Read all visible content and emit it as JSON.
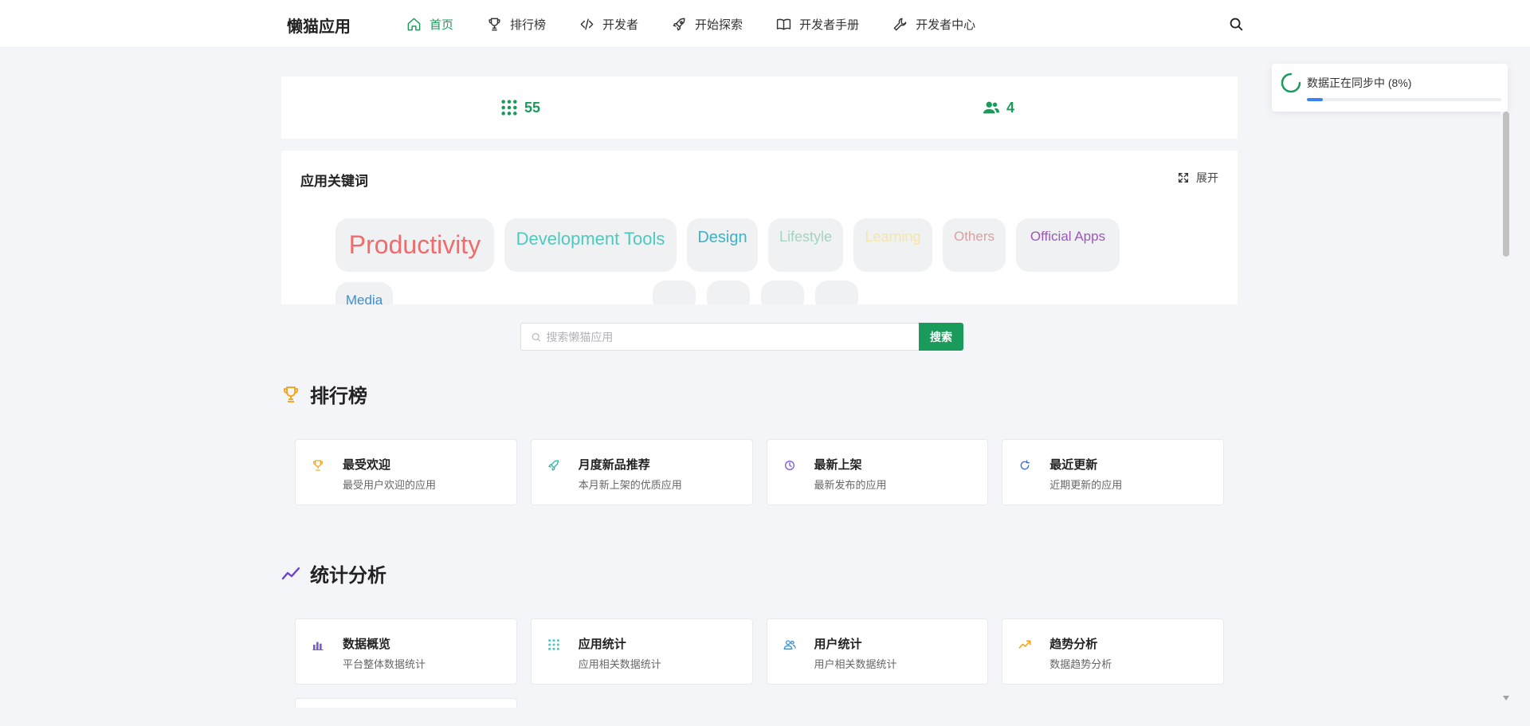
{
  "header": {
    "logo": "懒猫应用",
    "nav": [
      {
        "label": "首页",
        "icon": "home-icon",
        "active": true
      },
      {
        "label": "排行榜",
        "icon": "trophy-icon"
      },
      {
        "label": "开发者",
        "icon": "code-icon"
      },
      {
        "label": "开始探索",
        "icon": "rocket-icon"
      },
      {
        "label": "开发者手册",
        "icon": "book-icon"
      },
      {
        "label": "开发者中心",
        "icon": "wrench-icon"
      }
    ],
    "search_icon": "search-icon"
  },
  "stats": {
    "apps_count": "55",
    "apps_icon": "grid-dots-icon",
    "users_count": "4",
    "users_icon": "users-icon"
  },
  "keywords": {
    "title": "应用关键词",
    "expand_label": "展开",
    "tags": [
      {
        "label": "Productivity",
        "color": "#f06b6b"
      },
      {
        "label": "Development Tools",
        "color": "#4fc9bd"
      },
      {
        "label": "Design",
        "color": "#3ab3c9"
      },
      {
        "label": "Lifestyle",
        "color": "#a3d4bf"
      },
      {
        "label": "Learning",
        "color": "#f8e6a0"
      },
      {
        "label": "Others",
        "color": "#d9a1a1"
      },
      {
        "label": "Official Apps",
        "color": "#9a57b8"
      },
      {
        "label": "Media",
        "color": "#3d8fd1"
      }
    ]
  },
  "search": {
    "placeholder": "搜索懒猫应用",
    "button_label": "搜索"
  },
  "ranking": {
    "title": "排行榜",
    "cards": [
      {
        "title": "最受欢迎",
        "desc": "最受用户欢迎的应用",
        "icon": "trophy-icon",
        "color": "#f5a623"
      },
      {
        "title": "月度新品推荐",
        "desc": "本月新上架的优质应用",
        "icon": "rocket-icon",
        "color": "#2bb5a0"
      },
      {
        "title": "最新上架",
        "desc": "最新发布的应用",
        "icon": "clock-icon",
        "color": "#7c5cd6"
      },
      {
        "title": "最近更新",
        "desc": "近期更新的应用",
        "icon": "refresh-icon",
        "color": "#3d6fd1"
      }
    ]
  },
  "analytics": {
    "title": "统计分析",
    "cards": [
      {
        "title": "数据概览",
        "desc": "平台整体数据统计",
        "icon": "bar-chart-icon",
        "color": "#7c5cd6"
      },
      {
        "title": "应用统计",
        "desc": "应用相关数据统计",
        "icon": "grid-dots-icon",
        "color": "#4fc9bd"
      },
      {
        "title": "用户统计",
        "desc": "用户相关数据统计",
        "icon": "users-icon",
        "color": "#3d8fd1"
      },
      {
        "title": "趋势分析",
        "desc": "数据趋势分析",
        "icon": "trend-icon",
        "color": "#f5a623"
      }
    ]
  },
  "sync_toast": {
    "text": "数据正在同步中 (8%)",
    "progress": 0.08,
    "spinner_color": "#1a9b5c",
    "bar_color": "#3b82f6"
  },
  "colors": {
    "accent": "#1a9b5c",
    "background": "#f4f5f9"
  }
}
